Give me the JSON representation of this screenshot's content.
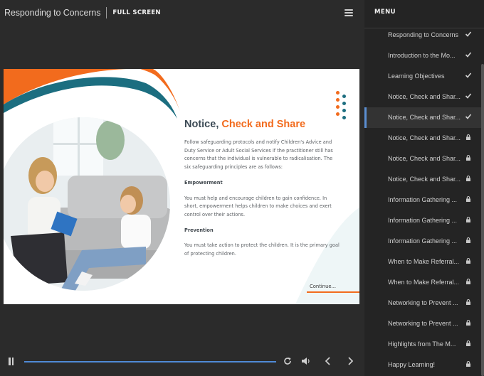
{
  "header": {
    "course_title": "Responding to Concerns",
    "fullscreen_label": "FULL SCREEN"
  },
  "slide": {
    "heading_part1": "Notice, ",
    "heading_part2": "Check and Share",
    "intro": "Follow safeguarding protocols and notify Children's Advice and Duty Service or Adult Social Services if the practitioner still has concerns that the individual is vulnerable to radicalisation. The six safeguarding principles are as follows:",
    "subheading1": "Empowerment",
    "para1": "You must help and encourage children to gain confidence. In short, empowerment helps children to make choices and exert control over their actions.",
    "subheading2": "Prevention",
    "para2": "You must take action to protect the children. It is the primary goal of protecting children.",
    "continue_label": "Continue...",
    "colors": {
      "orange": "#f26b1d",
      "teal": "#1c6e80",
      "heading": "#3c4a55"
    }
  },
  "player": {
    "progress": 1.0,
    "icons": [
      "pause-icon",
      "replay-icon",
      "volume-icon",
      "previous-icon",
      "next-icon"
    ]
  },
  "sidebar": {
    "title": "MENU",
    "items": [
      {
        "label": "Responding to Concerns",
        "status": "complete"
      },
      {
        "label": "Introduction to the Mo...",
        "status": "complete"
      },
      {
        "label": "Learning Objectives",
        "status": "complete"
      },
      {
        "label": "Notice, Check and Shar...",
        "status": "complete"
      },
      {
        "label": "Notice, Check and Shar...",
        "status": "complete",
        "active": true
      },
      {
        "label": "Notice, Check and Shar...",
        "status": "locked"
      },
      {
        "label": "Notice, Check and Shar...",
        "status": "locked"
      },
      {
        "label": "Notice, Check and Shar...",
        "status": "locked"
      },
      {
        "label": "Information Gathering ...",
        "status": "locked"
      },
      {
        "label": "Information Gathering ...",
        "status": "locked"
      },
      {
        "label": "Information Gathering ...",
        "status": "locked"
      },
      {
        "label": "When to Make Referral...",
        "status": "locked"
      },
      {
        "label": "When to Make Referral...",
        "status": "locked"
      },
      {
        "label": "Networking to Prevent ...",
        "status": "locked"
      },
      {
        "label": "Networking to Prevent ...",
        "status": "locked"
      },
      {
        "label": "Highlights from The M...",
        "status": "locked"
      },
      {
        "label": "Happy Learning!",
        "status": "locked"
      }
    ]
  }
}
